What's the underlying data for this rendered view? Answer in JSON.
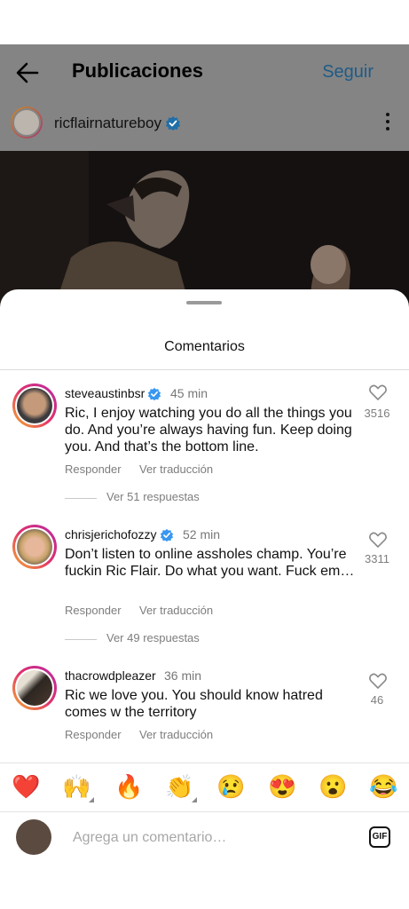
{
  "header": {
    "title": "Publicaciones",
    "follow_label": "Seguir",
    "back_icon": "arrow-left-icon"
  },
  "post_author": {
    "username": "ricflairnatureboy",
    "verified": true,
    "more_icon": "more-vertical-icon"
  },
  "sheet": {
    "title": "Comentarios"
  },
  "comments": [
    {
      "username": "steveaustinbsr",
      "verified": true,
      "time": "45 min",
      "text": "Ric, I enjoy watching you do all the things you do. And you’re always having fun. Keep doing you. And that’s the bottom line.",
      "reply_label": "Responder",
      "translate_label": "Ver traducción",
      "likes": "3516",
      "replies_label": "Ver 51 respuestas"
    },
    {
      "username": "chrisjerichofozzy",
      "verified": true,
      "time": "52 min",
      "text": "Don’t listen to online assholes champ. You’re fuckin Ric Flair. Do what you want. Fuck em…",
      "reply_label": "Responder",
      "translate_label": "Ver traducción",
      "likes": "3311",
      "replies_label": "Ver 49 respuestas"
    },
    {
      "username": "thacrowdpleazer",
      "verified": false,
      "time": "36 min",
      "text": "Ric we love you. You should know hatred comes w the territory",
      "reply_label": "Responder",
      "translate_label": "Ver traducción",
      "likes": "46"
    }
  ],
  "emoji_bar": [
    {
      "glyph": "❤️",
      "name": "red-heart"
    },
    {
      "glyph": "🙌",
      "name": "raised-hands",
      "has_variants": true
    },
    {
      "glyph": "🔥",
      "name": "fire"
    },
    {
      "glyph": "👏",
      "name": "clapping-hands",
      "has_variants": true
    },
    {
      "glyph": "😢",
      "name": "crying-face"
    },
    {
      "glyph": "😍",
      "name": "heart-eyes"
    },
    {
      "glyph": "😮",
      "name": "open-mouth"
    },
    {
      "glyph": "😂",
      "name": "tears-of-joy"
    }
  ],
  "composer": {
    "placeholder": "Agrega un comentario…",
    "gif_label": "GIF"
  },
  "colors": {
    "accent": "#1f5b86",
    "verified": "#3897f0",
    "dim_overlay": "#848484"
  }
}
